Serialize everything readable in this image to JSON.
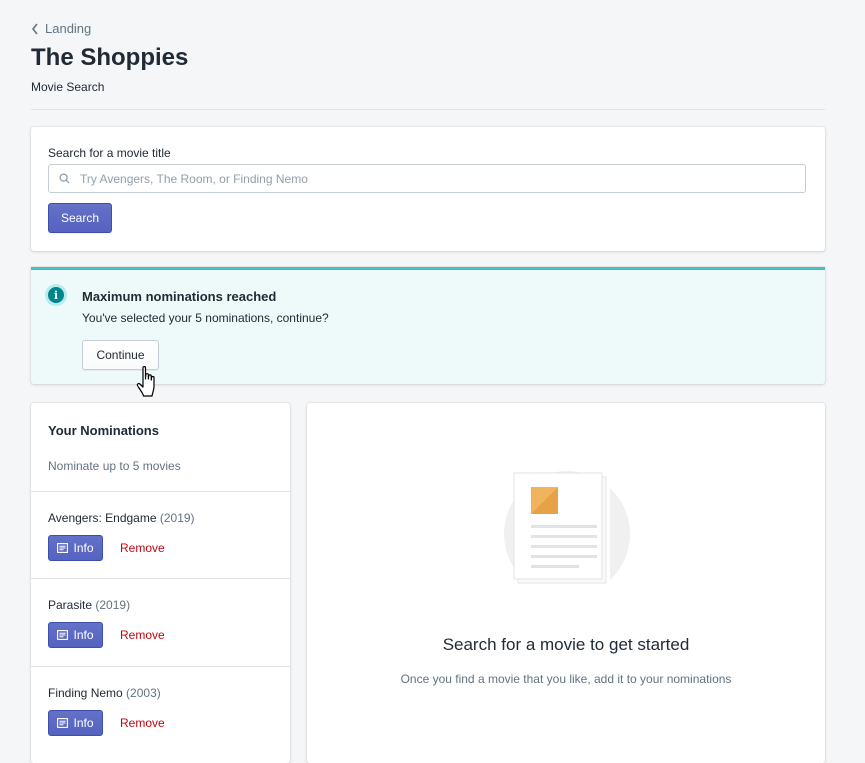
{
  "nav": {
    "back_label": "Landing"
  },
  "header": {
    "title": "The Shoppies",
    "subtitle": "Movie Search"
  },
  "search": {
    "label": "Search for a movie title",
    "placeholder": "Try Avengers, The Room, or Finding Nemo",
    "value": "",
    "button_label": "Search"
  },
  "banner": {
    "title": "Maximum nominations reached",
    "text": "You've selected your 5 nominations, continue?",
    "button_label": "Continue",
    "icon": "info-icon"
  },
  "nominations": {
    "title": "Your Nominations",
    "subtitle": "Nominate up to 5 movies",
    "items": [
      {
        "title": "Avengers: Endgame",
        "year": "(2019)",
        "info_label": "Info",
        "remove_label": "Remove"
      },
      {
        "title": "Parasite",
        "year": "(2019)",
        "info_label": "Info",
        "remove_label": "Remove"
      },
      {
        "title": "Finding Nemo",
        "year": "(2003)",
        "info_label": "Info",
        "remove_label": "Remove"
      }
    ]
  },
  "empty_state": {
    "title": "Search for a movie to get started",
    "text": "Once you find a movie that you like, add it to your nominations"
  },
  "colors": {
    "primary": "#5c6ac4",
    "banner_accent": "#47c1bf",
    "banner_bg": "#eef9f9",
    "destructive": "#bf0711"
  }
}
